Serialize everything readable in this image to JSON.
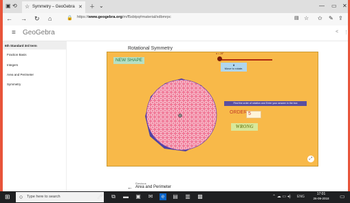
{
  "browser": {
    "tab_title": "Symmetry – GeoGebra",
    "url_prefix": "https://",
    "url_domain": "www.geogebra.org",
    "url_rest": "/m/f5sbtpq#material/xdbmrpc"
  },
  "geogebra": {
    "brand": "GeoGebra"
  },
  "sidebar": {
    "header": "6th Standard 3rd term",
    "items": [
      {
        "label": "Fraction Basis"
      },
      {
        "label": "Integers"
      },
      {
        "label": "Area and Perimeter"
      },
      {
        "label": "Symmetry"
      }
    ]
  },
  "main": {
    "title": "Rotational Symmetry",
    "applet": {
      "new_shape": "NEW SHAPE",
      "slider_value": "α = 28°",
      "hint_num": "8",
      "hint_text": "Move to rotate.",
      "instruction": "Find the order of rotation and Enter your answer in the box",
      "order_label": "ORDER",
      "order_value": "5",
      "result": "WRONG"
    },
    "previous_label": "Previous",
    "previous_link": "Area and Perimeter"
  },
  "taskbar": {
    "search_placeholder": "Type here to search",
    "time": "17:01",
    "date": "26-09-2018",
    "lang": "ENG"
  },
  "colors": {
    "applet_bg": "#f8b949",
    "shape_fill": "#f07a98",
    "polygon_fill": "#4f43a3",
    "desktop_accent": "#e8543a"
  }
}
